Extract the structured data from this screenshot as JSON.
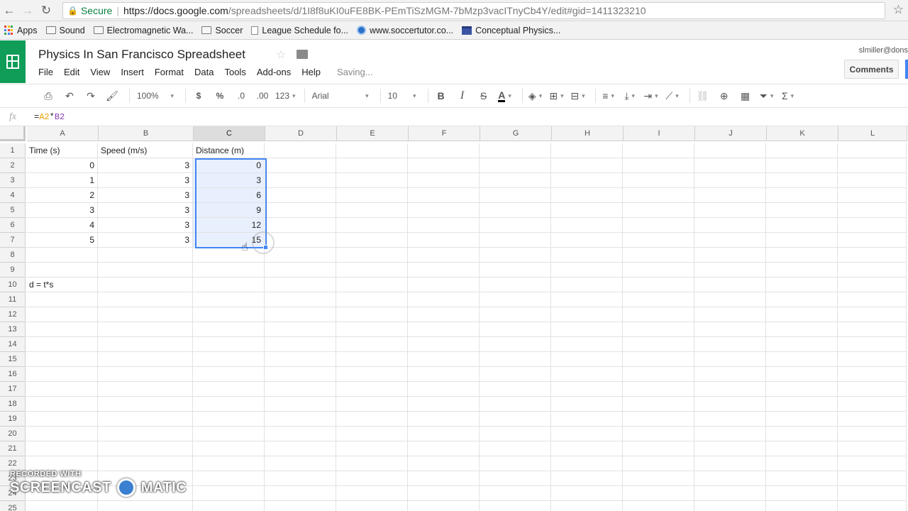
{
  "browser": {
    "back_icon": "back-arrow-icon",
    "forward_icon": "forward-arrow-icon",
    "reload_icon": "reload-icon",
    "secure_label": "Secure",
    "url_host": "https://docs.google.com",
    "url_path": "/spreadsheets/d/1I8f8uKI0uFE8BK-PEmTiSzMGM-7bMzp3vacITnyCb4Y/edit#gid=1411323210",
    "bookmarks": [
      {
        "label": "Apps",
        "icon": "apps-grid-icon"
      },
      {
        "label": "Sound",
        "icon": "folder-icon"
      },
      {
        "label": "Electromagnetic Wa...",
        "icon": "folder-icon"
      },
      {
        "label": "Soccer",
        "icon": "folder-icon"
      },
      {
        "label": "League Schedule fo...",
        "icon": "page-icon"
      },
      {
        "label": "www.soccertutor.co...",
        "icon": "soccer-ball-icon"
      },
      {
        "label": "Conceptual Physics...",
        "icon": "calendar-icon"
      }
    ]
  },
  "doc": {
    "title": "Physics In San Francisco Spreadsheet",
    "user": "slmiller@dons",
    "comments_label": "Comments",
    "menu": [
      "File",
      "Edit",
      "View",
      "Insert",
      "Format",
      "Data",
      "Tools",
      "Add-ons",
      "Help"
    ],
    "status": "Saving..."
  },
  "toolbar": {
    "zoom": "100%",
    "currency": "$",
    "percent": "%",
    "decrease_decimal": ".0",
    "increase_decimal": ".00",
    "more_formats": "123",
    "font": "Arial",
    "font_size": "10",
    "bold": "B",
    "italic": "I",
    "strike": "S",
    "text_color": "A"
  },
  "formula_bar": {
    "fx": "fx",
    "prefix": "=",
    "ref1": "A2",
    "op": "*",
    "ref2": "B2"
  },
  "columns": [
    "A",
    "B",
    "C",
    "D",
    "E",
    "F",
    "G",
    "H",
    "I",
    "J",
    "K",
    "L"
  ],
  "active_column": "C",
  "rows": [
    "1",
    "2",
    "3",
    "4",
    "5",
    "6",
    "7",
    "8",
    "9",
    "10",
    "11",
    "12",
    "13",
    "14",
    "15",
    "16",
    "17",
    "18",
    "19",
    "20",
    "21",
    "22",
    "23",
    "24",
    "25"
  ],
  "cells": {
    "header": [
      "Time (s)",
      "Speed (m/s)",
      "Distance (m)"
    ],
    "data": [
      [
        "0",
        "3",
        "0"
      ],
      [
        "1",
        "3",
        "3"
      ],
      [
        "2",
        "3",
        "6"
      ],
      [
        "3",
        "3",
        "9"
      ],
      [
        "4",
        "3",
        "12"
      ],
      [
        "5",
        "3",
        "15"
      ]
    ],
    "note": "d = t*s"
  },
  "watermark": {
    "line1": "RECORDED WITH",
    "line2a": "SCREENCAST",
    "line2b": "MATIC"
  }
}
